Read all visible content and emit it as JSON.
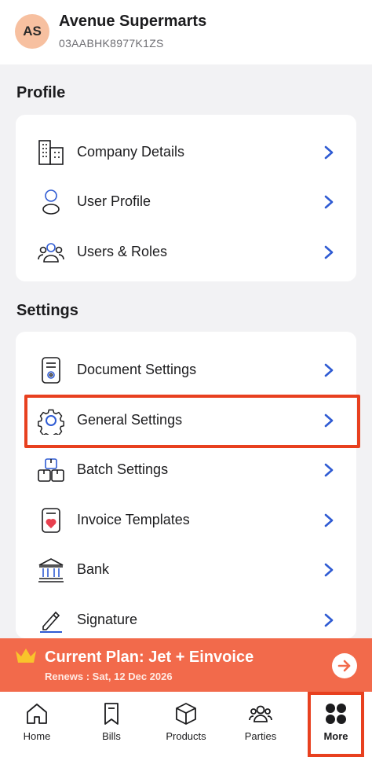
{
  "header": {
    "avatar_initials": "AS",
    "company_name": "Avenue Supermarts",
    "gstin": "03AABHK8977K1ZS"
  },
  "profile": {
    "title": "Profile",
    "items": [
      {
        "label": "Company Details",
        "icon": "building-icon"
      },
      {
        "label": "User Profile",
        "icon": "user-icon"
      },
      {
        "label": "Users & Roles",
        "icon": "users-group-icon"
      }
    ]
  },
  "settings": {
    "title": "Settings",
    "items": [
      {
        "label": "Document Settings",
        "icon": "document-settings-icon"
      },
      {
        "label": "General Settings",
        "icon": "gear-icon"
      },
      {
        "label": "Batch Settings",
        "icon": "boxes-icon"
      },
      {
        "label": "Invoice Templates",
        "icon": "invoice-template-icon"
      },
      {
        "label": "Bank",
        "icon": "bank-icon"
      },
      {
        "label": "Signature",
        "icon": "pen-icon"
      }
    ]
  },
  "plan": {
    "title": "Current Plan: Jet + Einvoice",
    "renews": "Renews : Sat, 12 Dec 2026"
  },
  "tabs": [
    {
      "label": "Home",
      "icon": "home-icon"
    },
    {
      "label": "Bills",
      "icon": "bookmark-icon"
    },
    {
      "label": "Products",
      "icon": "box-icon"
    },
    {
      "label": "Parties",
      "icon": "parties-icon"
    },
    {
      "label": "More",
      "icon": "grid-icon",
      "active": true
    }
  ],
  "colors": {
    "accent": "#2f5bd3",
    "highlight": "#e8401f",
    "plan_banner": "#f26a4b",
    "avatar_bg": "#f7c0a0"
  }
}
